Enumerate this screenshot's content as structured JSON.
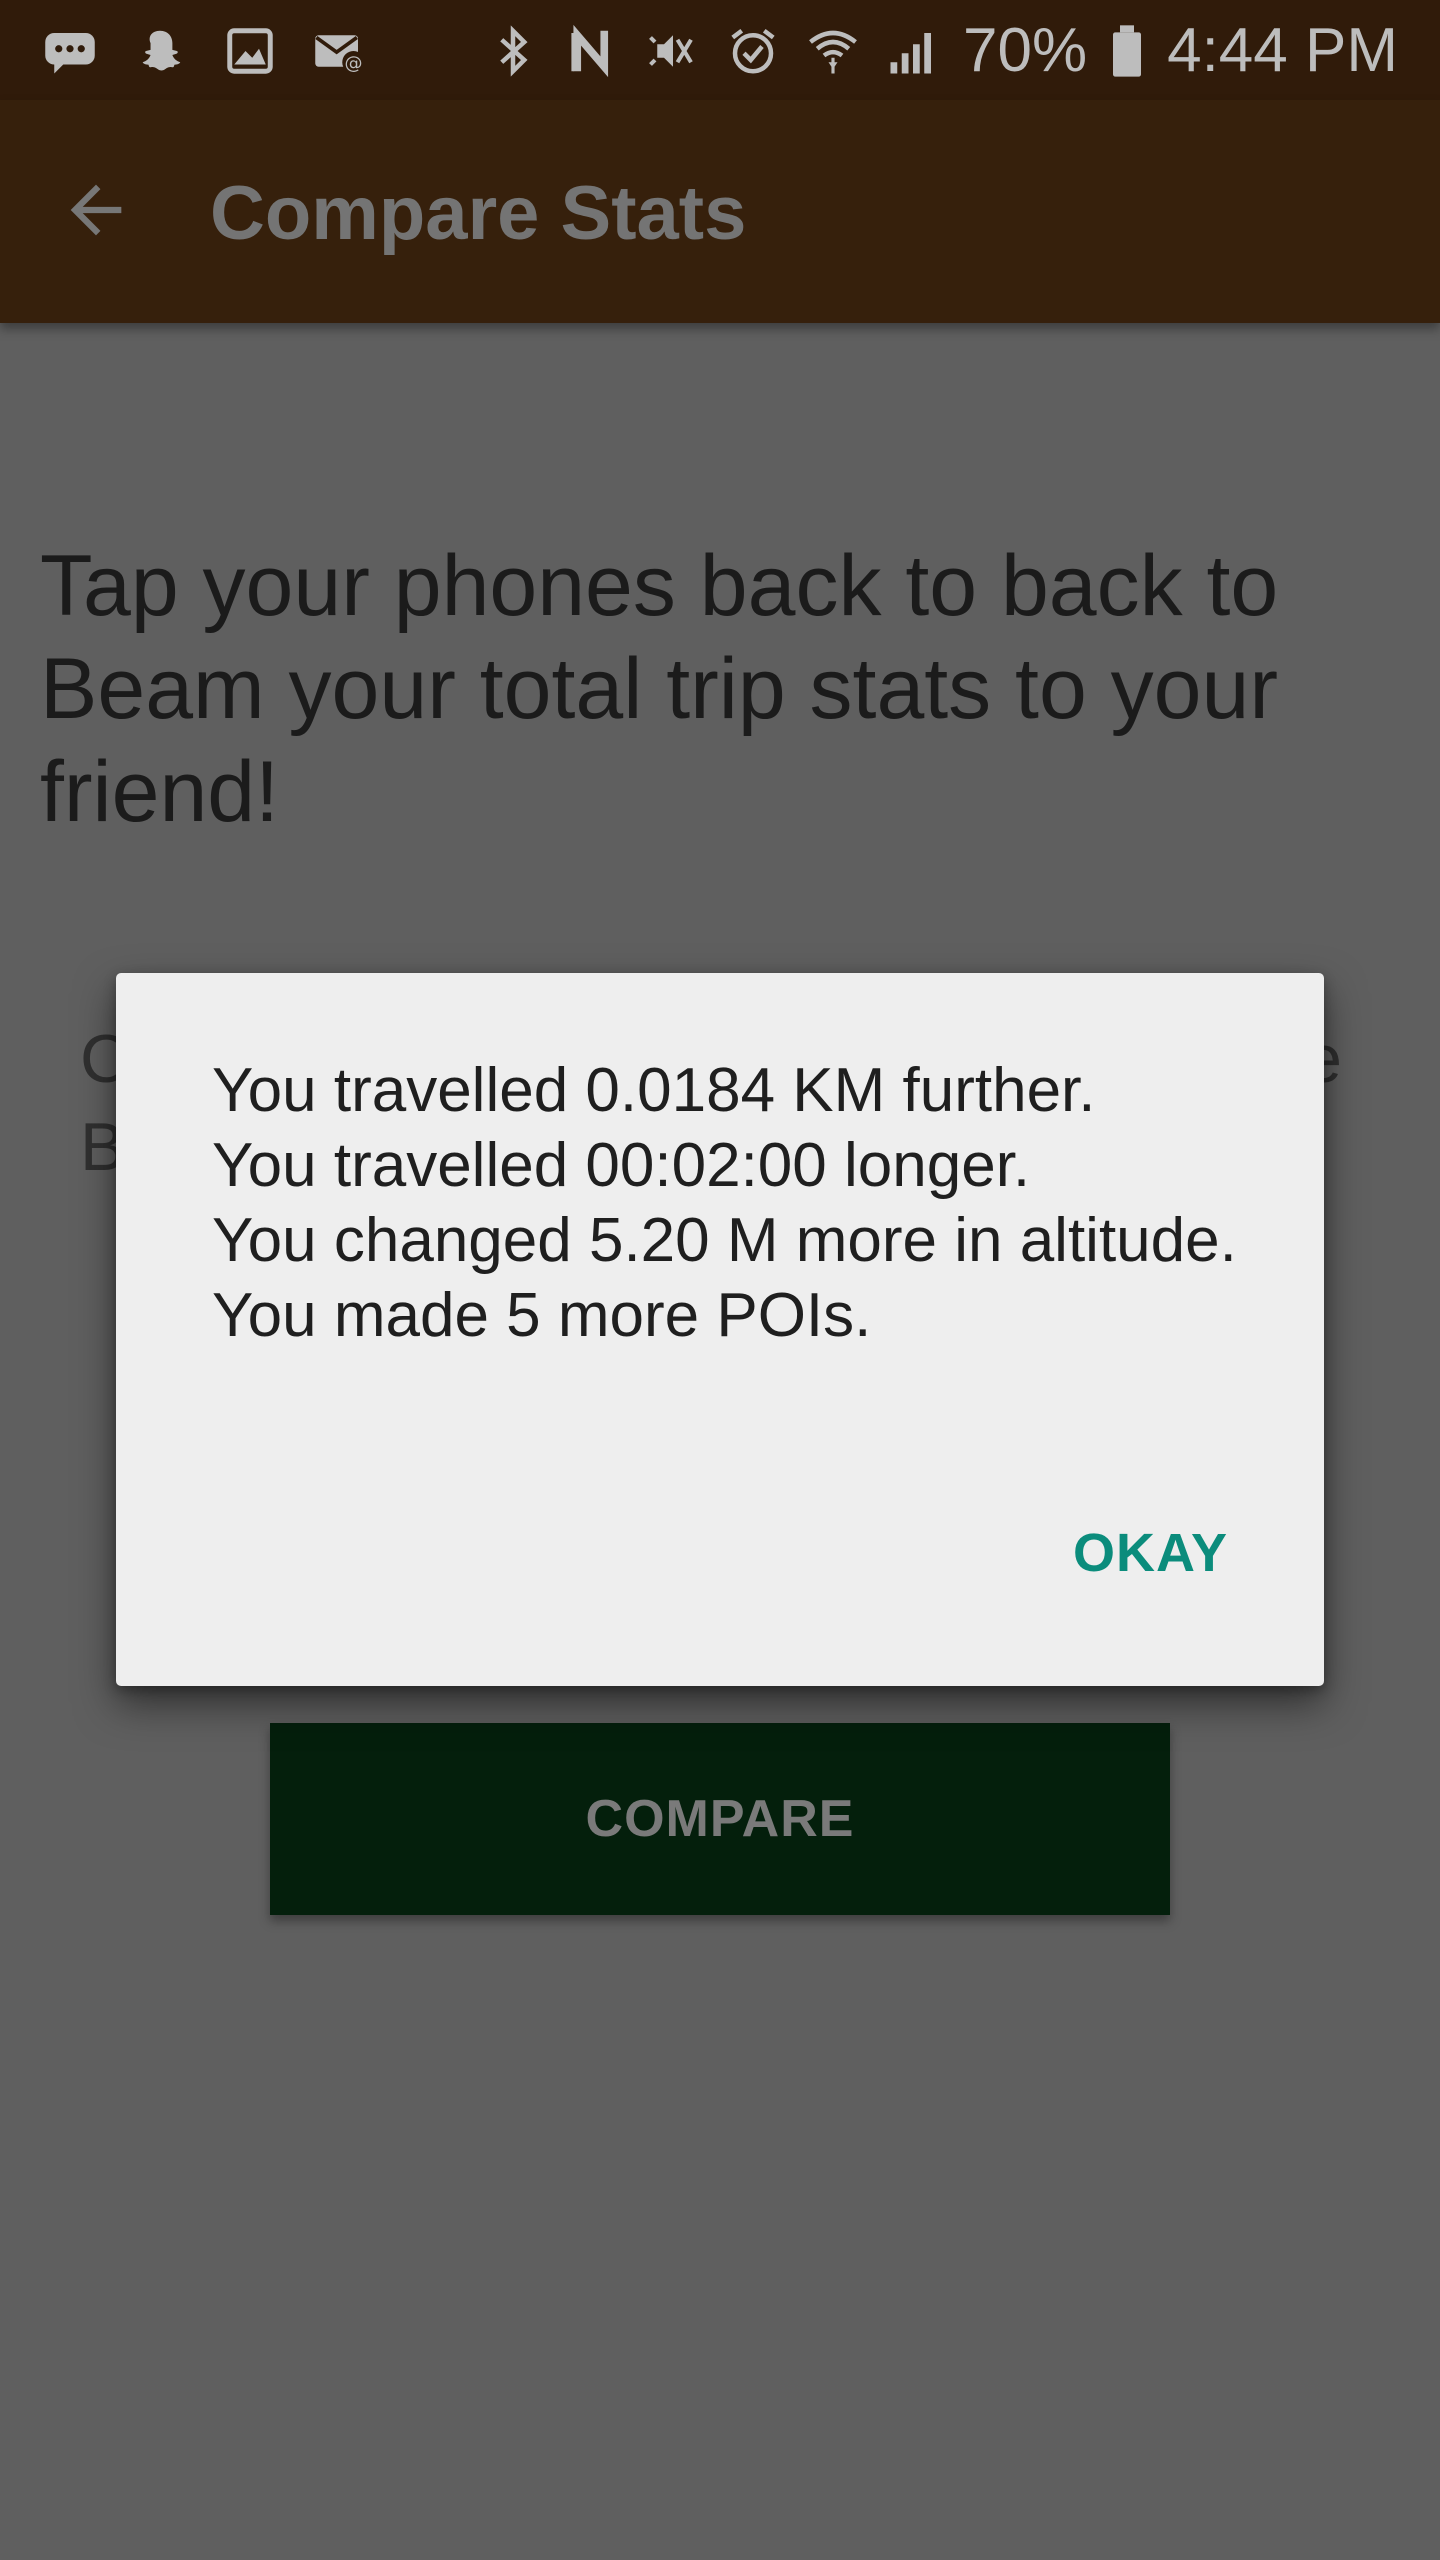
{
  "status_bar": {
    "left_icons": [
      "messages-icon",
      "snapchat-icon",
      "gallery-icon",
      "email-icon"
    ],
    "right_icons": [
      "bluetooth-icon",
      "nfc-icon",
      "mute-icon",
      "alarm-icon",
      "wifi-icon",
      "signal-icon"
    ],
    "battery_text": "70%",
    "time": "4:44 PM"
  },
  "toolbar": {
    "title": "Compare Stats"
  },
  "main": {
    "instructions": "Tap your phones back to back to Beam your total trip stats to your friend!",
    "hidden_line1_start": "C",
    "hidden_line1_end": "e",
    "hidden_line2_start": "B",
    "compare_label": "COMPARE"
  },
  "dialog": {
    "lines": [
      "You travelled 0.0184 KM further.",
      "You travelled 00:02:00 longer.",
      "You changed 5.20 M more in altitude.",
      "You made 5 more POIs."
    ],
    "okay_label": "OKAY"
  },
  "colors": {
    "status_bar": "#301b0a",
    "toolbar": "#36200c",
    "scrim_background": "#5f5f5f",
    "compare_button": "#041f0c",
    "accent": "#0b8c7c",
    "dialog_bg": "#eeeeee"
  }
}
